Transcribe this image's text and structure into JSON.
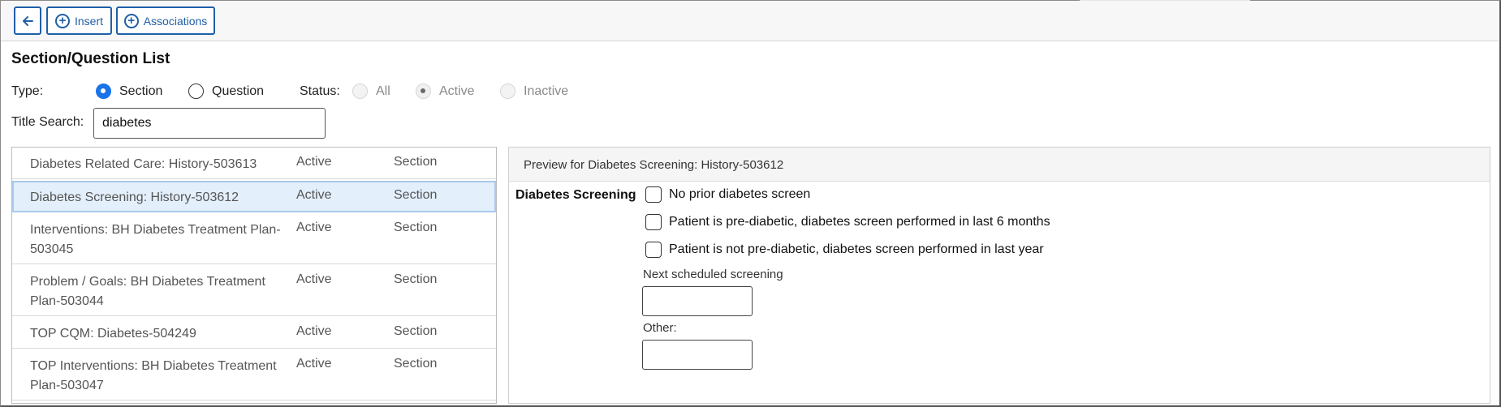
{
  "toolbar": {
    "back_icon": "arrow-left-icon",
    "insert_label": "Insert",
    "insert_icon": "plus-circle-icon",
    "associations_label": "Associations",
    "associations_icon": "plus-circle-icon"
  },
  "page": {
    "title": "Section/Question List"
  },
  "filters": {
    "type_label": "Type:",
    "type_options": [
      {
        "label": "Section",
        "selected": true
      },
      {
        "label": "Question",
        "selected": false
      }
    ],
    "status_label": "Status:",
    "status_options": [
      {
        "label": "All",
        "selected": false,
        "disabled": true
      },
      {
        "label": "Active",
        "selected": true,
        "disabled": true
      },
      {
        "label": "Inactive",
        "selected": false,
        "disabled": true
      }
    ],
    "title_search_label": "Title Search:",
    "title_search_value": "diabetes"
  },
  "list": {
    "rows": [
      {
        "title": "Diabetes Related Care: History-503613",
        "status": "Active",
        "type": "Section",
        "selected": false
      },
      {
        "title": "Diabetes Screening: History-503612",
        "status": "Active",
        "type": "Section",
        "selected": true
      },
      {
        "title": "Interventions: BH Diabetes Treatment Plan-503045",
        "status": "Active",
        "type": "Section",
        "selected": false
      },
      {
        "title": "Problem / Goals: BH Diabetes Treatment Plan-503044",
        "status": "Active",
        "type": "Section",
        "selected": false
      },
      {
        "title": "TOP CQM: Diabetes-504249",
        "status": "Active",
        "type": "Section",
        "selected": false
      },
      {
        "title": "TOP Interventions: BH Diabetes Treatment Plan-503047",
        "status": "Active",
        "type": "Section",
        "selected": false
      }
    ]
  },
  "preview": {
    "header": "Preview for Diabetes Screening: History-503612",
    "section_label": "Diabetes Screening",
    "checkboxes": [
      "No prior diabetes screen",
      "Patient is pre-diabetic, diabetes screen performed in last 6 months",
      "Patient is not pre-diabetic, diabetes screen performed in last year"
    ],
    "next_screening_label": "Next scheduled screening",
    "next_screening_value": "",
    "other_label": "Other:",
    "other_value": ""
  },
  "colors": {
    "accent": "#1f5fa8",
    "radio_selected": "#1a73e8",
    "selected_row": "#e3effb"
  }
}
